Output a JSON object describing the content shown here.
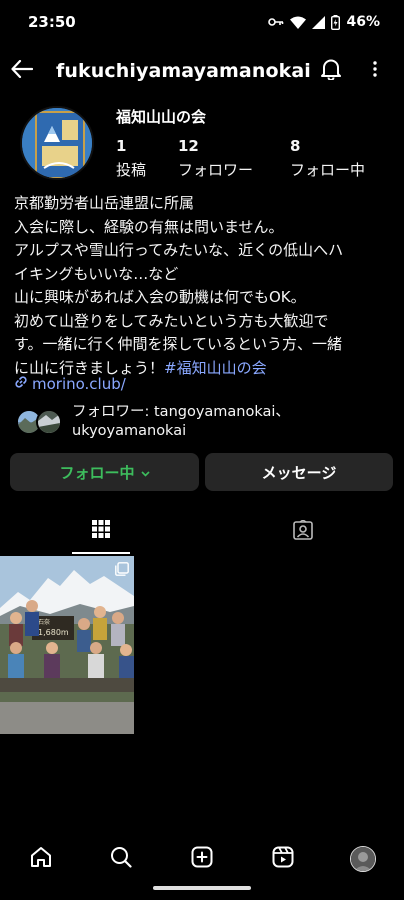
{
  "status_bar": {
    "time": "23:50",
    "battery": "46%"
  },
  "header": {
    "username": "fukuchiyamayamanokai",
    "icons": [
      "back-arrow-icon",
      "bell-icon",
      "more-vertical-icon"
    ]
  },
  "profile": {
    "name": "福知山山の会",
    "stats": [
      {
        "value": "1",
        "label": "投稿"
      },
      {
        "value": "12",
        "label": "フォロワー"
      },
      {
        "value": "8",
        "label": "フォロー中"
      }
    ],
    "avatar_text": "福知山山の会"
  },
  "bio": {
    "lines": [
      "京都勤労者山岳連盟に所属",
      "入会に際し、経験の有無は問いません。",
      "アルプスや雪山行ってみたいな、近くの低山へハ",
      "イキングもいいな…など",
      "山に興味があれば入会の動機は何でもOK。",
      "初めて山登りをしてみたいという方も大歓迎で",
      "す。一緒に行く仲間を探しているという方、一緒",
      "に山に行きましょう！"
    ],
    "hashtag": "#福知山山の会",
    "link": "morino.club/"
  },
  "followers": {
    "line1": "フォロワー: tangoyamanokai、",
    "line2": "ukyoyamanokai"
  },
  "buttons": {
    "follow": "フォロー中",
    "message": "メッセージ"
  },
  "post": {
    "sign_text": "1,680m",
    "sign_name": "石奈"
  },
  "tabs": [
    "grid-icon",
    "tagged-icon"
  ],
  "bottom_nav": [
    "home-icon",
    "search-icon",
    "create-icon",
    "reels-icon",
    "profile-avatar"
  ],
  "colors": {
    "background": "#000000",
    "button_bg": "#262626",
    "follow_green": "#3dbd5d",
    "link_blue": "#8aa8ff"
  }
}
